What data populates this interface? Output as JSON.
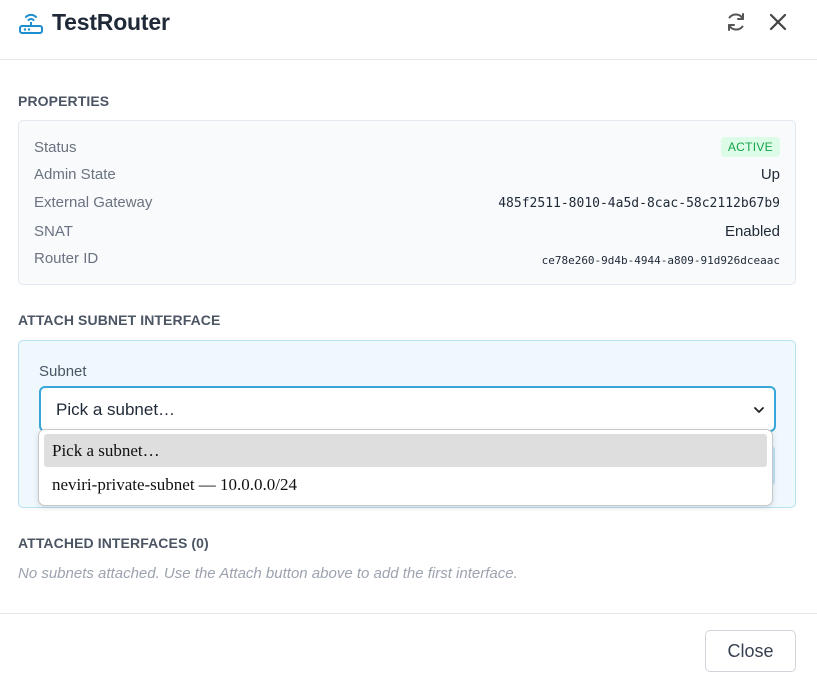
{
  "header": {
    "title": "TestRouter",
    "icon": "router-icon",
    "actions": [
      "refresh-icon",
      "close-icon"
    ]
  },
  "properties": {
    "section_title": "PROPERTIES",
    "rows": [
      {
        "label": "Status",
        "value": "ACTIVE"
      },
      {
        "label": "Admin State",
        "value": "Up"
      },
      {
        "label": "External Gateway",
        "value": "485f2511-8010-4a5d-8cac-58c2112b67b9"
      },
      {
        "label": "SNAT",
        "value": "Enabled"
      },
      {
        "label": "Router ID",
        "value": "ce78e260-9d4b-4944-a809-91d926dceaac"
      }
    ]
  },
  "attach": {
    "section_title": "ATTACH SUBNET INTERFACE",
    "subnet_label": "Subnet",
    "selected": "Pick a subnet…",
    "options": [
      "Pick a subnet…",
      "neviri-private-subnet — 10.0.0.0/24"
    ]
  },
  "attached": {
    "section_title": "ATTACHED INTERFACES (0)",
    "empty_text": "No subnets attached. Use the Attach button above to add the first interface."
  },
  "footer": {
    "close_label": "Close"
  },
  "colors": {
    "accent": "#38a6d8",
    "active_badge_bg": "#dcfce7",
    "active_badge_text": "#16a34a"
  }
}
